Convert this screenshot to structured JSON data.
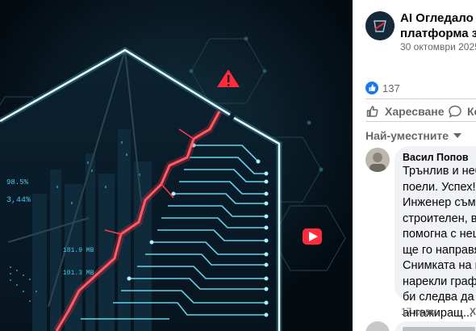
{
  "image": {
    "hud_numbers": [
      "98.5%",
      "3,44%",
      "181.9 MB",
      "101.3 MB"
    ],
    "warning_icon": "warning-triangle-icon",
    "play_icon": "play-icon",
    "accent_red": "#ff2a3c",
    "accent_cyan": "#5fe6ff"
  },
  "post": {
    "page_name_line1": "AI Огледало - П",
    "page_name_line2": "платформа за Д",
    "date": "30 октомври 2025",
    "reaction_icon": "thumbs-up-icon",
    "like_count": "137",
    "like_label": "Харесване",
    "comment_label": "Ко",
    "sort_label": "Най-уместните"
  },
  "comments": [
    {
      "author": "Васил Попов",
      "lines": [
        "Трънлив и небл",
        "поели. Успех!",
        "Инженер съм. Б",
        "строителен, в п",
        "помогна с нещ",
        "ще го направя.",
        "Снимката на пр",
        "нарекли графи",
        "би следва да бъ"
      ],
      "last_line": "ангажиращ...",
      "see_more": "В",
      "time": "17 седм.",
      "like_label": "Харесв"
    }
  ]
}
